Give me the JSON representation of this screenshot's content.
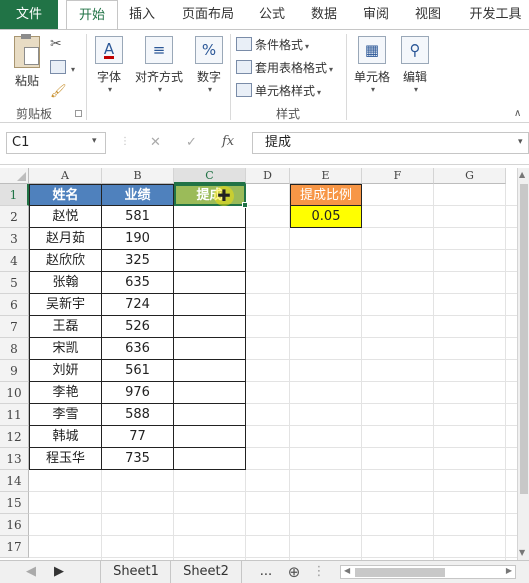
{
  "ribbon_tabs": [
    "文件",
    "开始",
    "插入",
    "页面布局",
    "公式",
    "数据",
    "审阅",
    "视图",
    "开发工具"
  ],
  "ribbon": {
    "clipboard": {
      "paste": "粘贴",
      "group": "剪贴板"
    },
    "font": "字体",
    "alignment": "对齐方式",
    "number": "数字",
    "styles": {
      "conditional": "条件格式",
      "table": "套用表格格式",
      "cell_styles": "单元格样式",
      "group": "样式"
    },
    "cells": "单元格",
    "editing": "编辑"
  },
  "formula_bar": {
    "name_box": "C1",
    "cancel": "✕",
    "enter": "✓",
    "fx": "fx",
    "content": "提成"
  },
  "columns": [
    "A",
    "B",
    "C",
    "D",
    "E",
    "F",
    "G"
  ],
  "rows": [
    "1",
    "2",
    "3",
    "4",
    "5",
    "6",
    "7",
    "8",
    "9",
    "10",
    "11",
    "12",
    "13",
    "14",
    "15",
    "16",
    "17"
  ],
  "table": {
    "headers": [
      "姓名",
      "业绩",
      "提成"
    ],
    "names": [
      "赵悦",
      "赵月茹",
      "赵欣欣",
      "张翰",
      "吴新宇",
      "王磊",
      "宋凯",
      "刘妍",
      "李艳",
      "李雪",
      "韩城",
      "程玉华"
    ],
    "values": [
      "581",
      "190",
      "325",
      "635",
      "724",
      "526",
      "636",
      "561",
      "976",
      "588",
      "77",
      "735"
    ]
  },
  "ratio": {
    "label": "提成比例",
    "value": "0.05"
  },
  "sheets": [
    "Sheet1",
    "Sheet2"
  ],
  "sheet_more": "...",
  "colors": {
    "header_blue": "#4f81bd",
    "header_green": "#9bbb59",
    "ratio_orange": "#f79646",
    "ratio_yellow": "#ffff00",
    "brand": "#217346"
  }
}
